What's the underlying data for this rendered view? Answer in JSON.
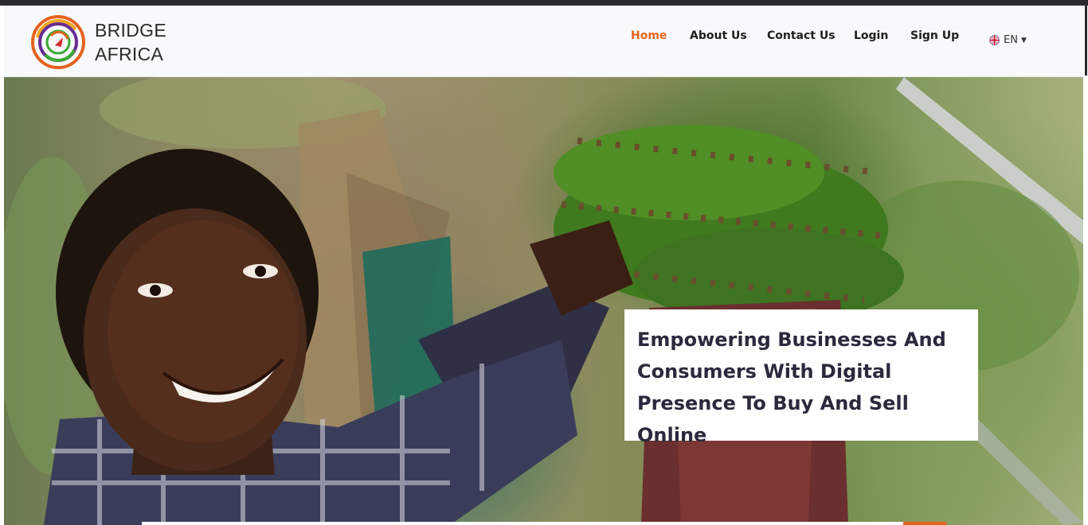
{
  "brand": {
    "line1": "BRIDGE",
    "line2": "AFRICA",
    "logo_icon": "bridge-africa-logo"
  },
  "nav": {
    "items": [
      {
        "label": "Home",
        "active": true
      },
      {
        "label": "About Us",
        "active": false
      },
      {
        "label": "Contact Us",
        "active": false
      },
      {
        "label": "Login",
        "active": false
      },
      {
        "label": "Sign Up",
        "active": false
      }
    ],
    "language": {
      "label": "EN",
      "icon": "uk-flag-icon"
    }
  },
  "hero": {
    "headline": "Empowering Businesses And Consumers With Digital Presence To Buy And Sell Online",
    "image": "smiling man holding bunch of green bananas in plantation"
  },
  "colors": {
    "accent": "#e5621e",
    "nav_text": "#1e1e1e",
    "headline": "#2a2a3c",
    "navbar_bg": "#f8f9fa"
  }
}
